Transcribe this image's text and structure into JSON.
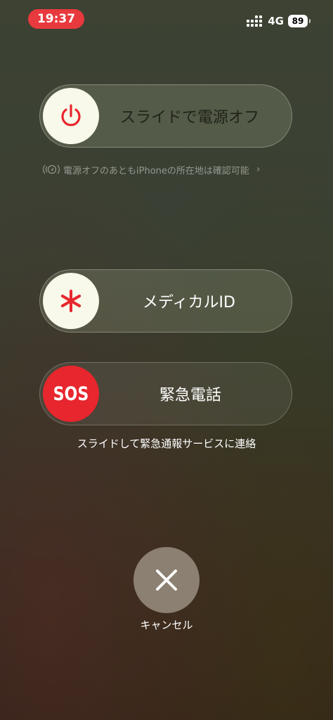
{
  "status_bar": {
    "time": "19:37",
    "network": "4G",
    "battery": "89"
  },
  "power_slider": {
    "label": "スライドで電源オフ",
    "icon": "power-icon"
  },
  "find_my_note": {
    "text": "電源オフのあともiPhoneの所在地は確認可能",
    "icon": "location-signal-icon",
    "chevron": "›"
  },
  "medical_slider": {
    "label": "メディカルID",
    "icon": "asterisk-icon"
  },
  "sos_slider": {
    "knob_text": "SOS",
    "label": "緊急電話"
  },
  "sos_hint": "スライドして緊急通報サービスに連絡",
  "cancel": {
    "label": "キャンセル",
    "icon": "close-icon"
  },
  "colors": {
    "status_time_bg": "#e8393e",
    "sos_red": "#e8262d",
    "knob_light": "#f8f9ea",
    "cancel_bg": "#8b8071"
  }
}
